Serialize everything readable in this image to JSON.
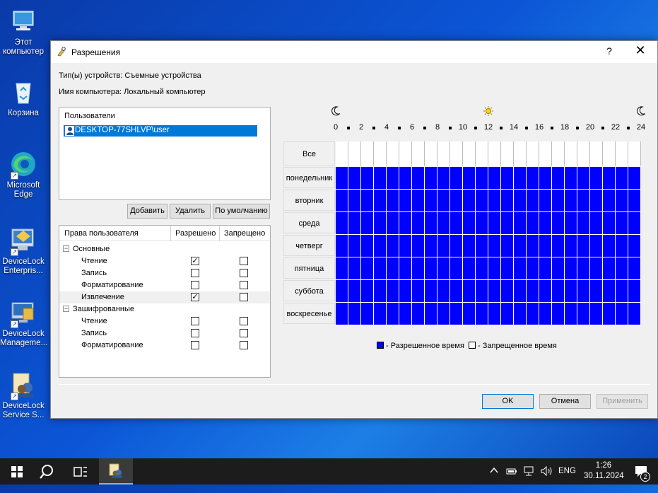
{
  "desktop": {
    "icons": [
      {
        "label": "Этот компьютер",
        "icon": "this-pc-icon"
      },
      {
        "label": "Корзина",
        "icon": "recycle-bin-icon"
      },
      {
        "label": "Microsoft Edge",
        "icon": "edge-icon"
      },
      {
        "label": "DeviceLock Enterpris...",
        "icon": "devicelock-enterprise-icon"
      },
      {
        "label": "DeviceLock Manageme...",
        "icon": "devicelock-management-icon"
      },
      {
        "label": "DeviceLock Service S...",
        "icon": "devicelock-service-icon"
      }
    ]
  },
  "dialog": {
    "title": "Разрешения",
    "help_label": "?",
    "close_label": "✕",
    "device_type": "Тип(ы) устройств: Съемные устройства",
    "computer_name": "Имя компьютера: Локальный компьютер",
    "users": {
      "header": "Пользователи",
      "items": [
        {
          "name": "DESKTOP-77SHLVP\\user",
          "selected": true
        }
      ]
    },
    "user_buttons": {
      "add": "Добавить",
      "delete": "Удалить",
      "default": "По умолчанию"
    },
    "rights": {
      "columns": {
        "name": "Права пользователя",
        "allowed": "Разрешено",
        "denied": "Запрещено"
      },
      "groups": [
        {
          "name": "Основные",
          "items": [
            {
              "name": "Чтение",
              "allowed": true,
              "denied": false
            },
            {
              "name": "Запись",
              "allowed": false,
              "denied": false
            },
            {
              "name": "Форматирование",
              "allowed": false,
              "denied": false
            },
            {
              "name": "Извлечение",
              "allowed": true,
              "denied": false,
              "selected": true
            }
          ]
        },
        {
          "name": "Зашифрованные",
          "items": [
            {
              "name": "Чтение",
              "allowed": false,
              "denied": false
            },
            {
              "name": "Запись",
              "allowed": false,
              "denied": false
            },
            {
              "name": "Форматирование",
              "allowed": false,
              "denied": false
            }
          ]
        }
      ]
    },
    "schedule": {
      "hour_labels": [
        "0",
        "2",
        "4",
        "6",
        "8",
        "10",
        "12",
        "14",
        "16",
        "18",
        "20",
        "22",
        "24"
      ],
      "all_label": "Все",
      "days": [
        "понедельник",
        "вторник",
        "среда",
        "четверг",
        "пятница",
        "суббота",
        "воскресенье"
      ],
      "allowed_fraction": 1,
      "legend_allowed": "- Разрешенное время",
      "legend_denied": "- Запрещенное время",
      "allowed_color": "#0000ff",
      "denied_color": "#ffffff"
    },
    "buttons": {
      "ok": "OK",
      "cancel": "Отмена",
      "apply": "Применить"
    }
  },
  "taskbar": {
    "lang": "ENG",
    "time": "1:26",
    "date": "30.11.2024",
    "notifications": "2"
  }
}
